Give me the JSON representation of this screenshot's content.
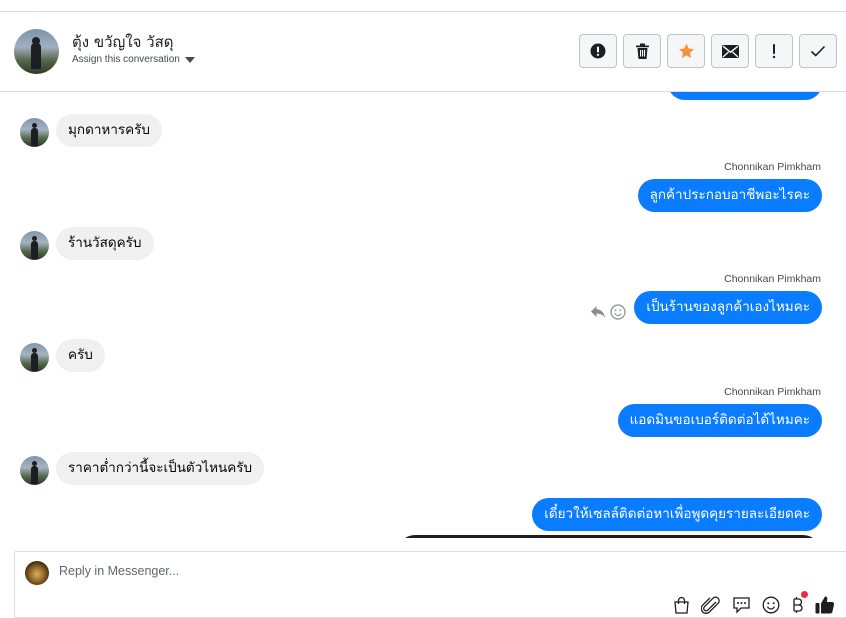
{
  "header": {
    "contact_name": "ตุ้ง ขวัญใจ วัสดุ",
    "assign_label": "Assign this conversation",
    "tools": [
      {
        "icon": "alert-circle-icon",
        "name": "mark-spam-button"
      },
      {
        "icon": "trash-icon",
        "name": "delete-button"
      },
      {
        "icon": "star-icon",
        "name": "star-button"
      },
      {
        "icon": "envelope-icon",
        "name": "mark-unread-button"
      },
      {
        "icon": "exclamation-icon",
        "name": "follow-up-button"
      },
      {
        "icon": "check-icon",
        "name": "mark-done-button"
      }
    ],
    "star_color": "#f7923a"
  },
  "messages": {
    "in1": "มุกดาหารครับ",
    "out1_sender": "Chonnikan Pimkham",
    "out1": "ลูกค้าประกอบอาชีพอะไรคะ",
    "in2": "ร้านวัสดุครับ",
    "out2_sender": "Chonnikan Pimkham",
    "out2": "เป็นร้านของลูกค้าเองไหมคะ",
    "in3": "ครับ",
    "out3_sender": "Chonnikan Pimkham",
    "out3": "แอดมินขอเบอร์ติดต่อได้ไหมคะ",
    "in4": "ราคาต่ำกว่านี้จะเป็นตัวไหนครับ",
    "out4": "เดี๋ยวให้เซลล์ติดต่อหาเพื่อพูดคุยรายละเอียดคะ"
  },
  "composer": {
    "placeholder": "Reply in Messenger...",
    "icons": [
      "shopping-bag-icon",
      "paperclip-icon",
      "saved-reply-icon",
      "emoji-icon",
      "baht-payment-icon",
      "thumbs-up-icon"
    ]
  },
  "colors": {
    "outgoing_bubble": "#0a7cff",
    "incoming_bubble": "#f0f0f0",
    "notification_dot": "#f02849"
  }
}
